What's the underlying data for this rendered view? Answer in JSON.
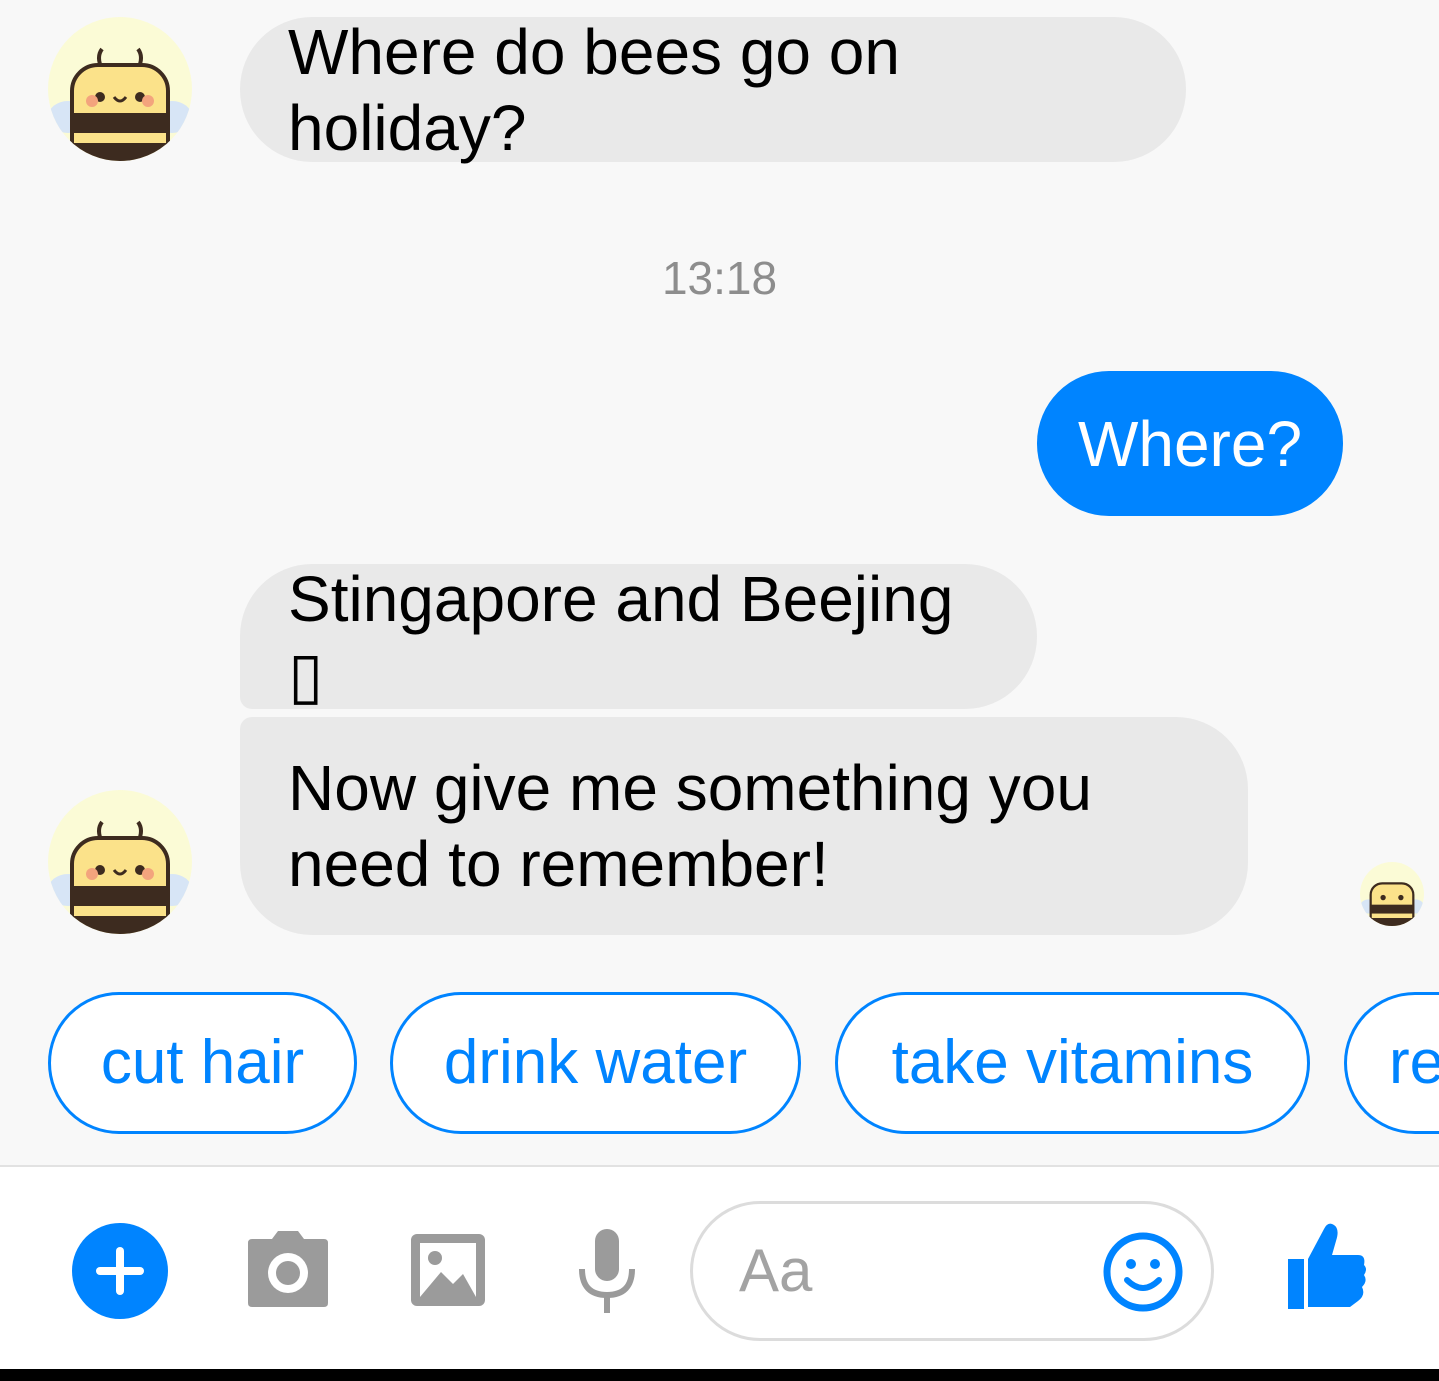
{
  "messages": [
    {
      "sender": "bot",
      "text": "Where do bees go on holiday?"
    },
    {
      "sender": "user",
      "text": "Where?"
    },
    {
      "sender": "bot",
      "text": "Stingapore and Beejing ▯"
    },
    {
      "sender": "bot",
      "text_lines": [
        "Now give me something you",
        "need to remember!"
      ]
    }
  ],
  "timestamp": "13:18",
  "quick_replies": [
    "cut hair",
    "drink water",
    "take vitamins",
    "re"
  ],
  "composer": {
    "placeholder": "Aa",
    "icons": [
      "plus-icon",
      "camera-icon",
      "image-icon",
      "microphone-icon",
      "emoji-icon",
      "thumbs-up-icon"
    ]
  },
  "avatar_icon": "bee-icon",
  "colors": {
    "accent": "#0084ff",
    "incoming_bubble": "#e9e9e9",
    "background": "#f8f8f8",
    "icon_gray": "#9b9b9b"
  }
}
